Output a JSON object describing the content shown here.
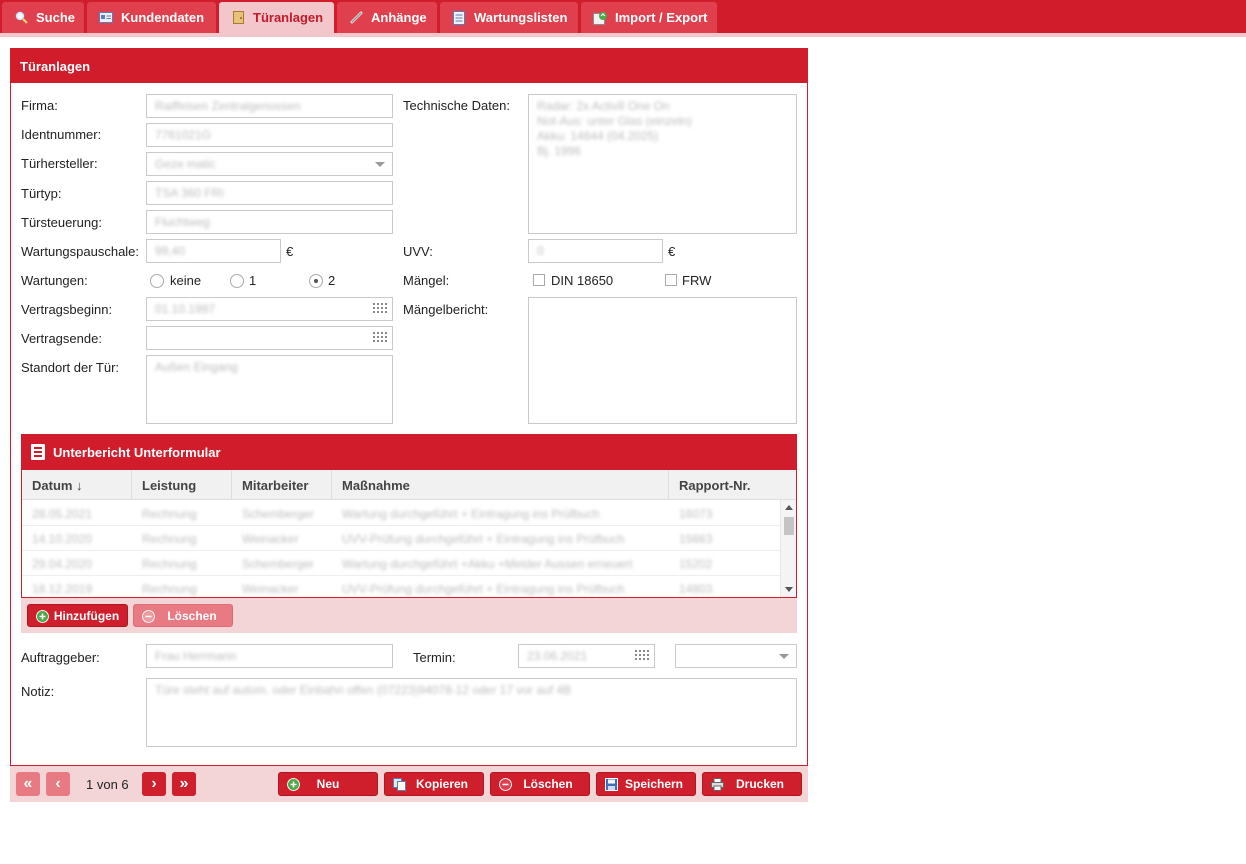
{
  "tabs": [
    {
      "label": "Suche"
    },
    {
      "label": "Kundendaten"
    },
    {
      "label": "Türanlagen"
    },
    {
      "label": "Anhänge"
    },
    {
      "label": "Wartungslisten"
    },
    {
      "label": "Import / Export"
    }
  ],
  "panel": {
    "title": "Türanlagen"
  },
  "form": {
    "firma": {
      "label": "Firma:",
      "value": "Raiffeisen Zentralgenossen"
    },
    "identnummer": {
      "label": "Identnummer:",
      "value": "7761021G"
    },
    "tuerhersteller": {
      "label": "Türhersteller:",
      "value": "Geze matic"
    },
    "tuertyp": {
      "label": "Türtyp:",
      "value": "TSA 360 FRI"
    },
    "tuersteuerung": {
      "label": "Türsteuerung:",
      "value": "Fluchtweg"
    },
    "wartungspauschale": {
      "label": "Wartungspauschale:",
      "value": "99,40",
      "currency": "€"
    },
    "wartungen": {
      "label": "Wartungen:",
      "options": [
        "keine",
        "1",
        "2"
      ],
      "selected": "2"
    },
    "vertragsbeginn": {
      "label": "Vertragsbeginn:",
      "value": "01.10.1997"
    },
    "vertragsende": {
      "label": "Vertragsende:",
      "value": ""
    },
    "standort": {
      "label": "Standort der Tür:",
      "value": "Außen Eingang"
    },
    "technische_daten": {
      "label": "Technische Daten:",
      "value": "Radar: 2x Activ8 One On\nNot-Aus: unter Glas (einzeln)\nAkku: 14644 (04.2025)\nBj. 1996"
    },
    "uvv": {
      "label": "UVV:",
      "value": "0",
      "currency": "€"
    },
    "maengel": {
      "label": "Mängel:",
      "options": [
        "DIN 18650",
        "FRW"
      ]
    },
    "maengelbericht": {
      "label": "Mängelbericht:",
      "value": ""
    },
    "auftraggeber": {
      "label": "Auftraggeber:",
      "value": "Frau Herrmann"
    },
    "termin": {
      "label": "Termin:",
      "value": "23.06.2021",
      "select": ""
    },
    "notiz": {
      "label": "Notiz:",
      "value": "Türe steht auf autom. oder Einbahn offen (07223)94078-12 oder 17 vor auf 4B"
    }
  },
  "subform": {
    "title": "Unterbericht Unterformular",
    "columns": [
      "Datum ↓",
      "Leistung",
      "Mitarbeiter",
      "Maßnahme",
      "Rapport-Nr."
    ],
    "rows": [
      [
        "28.05.2021",
        "Rechnung",
        "Schemberger",
        "Wartung durchgeführt + Eintragung ins Prüfbuch",
        "16073"
      ],
      [
        "14.10.2020",
        "Rechnung",
        "Weinacker",
        "UVV-Prüfung durchgeführt + Eintragung ins Prüfbuch",
        "15663"
      ],
      [
        "29.04.2020",
        "Rechnung",
        "Schemberger",
        "Wartung durchgeführt +Akku +Melder Aussen erneuert",
        "15202"
      ],
      [
        "18.12.2019",
        "Rechnung",
        "Weinacker",
        "UVV-Prüfung durchgeführt + Eintragung ins Prüfbuch",
        "14803"
      ]
    ],
    "add_label": "Hinzufügen",
    "delete_label": "Löschen"
  },
  "pager": {
    "text": "1 von 6",
    "first": "«",
    "prev": "‹",
    "next": "›",
    "last": "»"
  },
  "actions": {
    "new": "Neu",
    "copy": "Kopieren",
    "delete": "Löschen",
    "save": "Speichern",
    "print": "Drucken"
  },
  "colors": {
    "primary": "#d01c2b",
    "tab_inactive": "#e0404d",
    "light": "#f3c6cb",
    "disabled": "#e77a83"
  },
  "icons": [
    "search-icon",
    "id-card-icon",
    "door-icon",
    "paperclip-icon",
    "list-icon",
    "import-export-icon",
    "notebook-icon",
    "plus-icon",
    "minus-icon",
    "copy-icon",
    "save-icon",
    "print-icon",
    "calendar-icon",
    "chevron-down-icon"
  ]
}
